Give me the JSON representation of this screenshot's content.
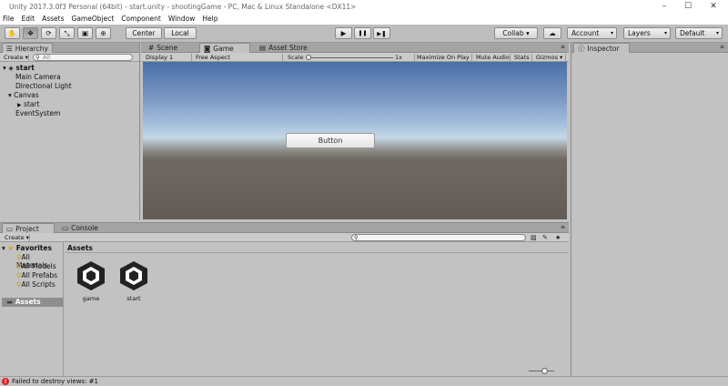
{
  "window": {
    "title": "Unity 2017.3.0f3 Personal (64bit) - start.unity - shootingGame - PC, Mac & Linux Standalone <DX11>"
  },
  "window_controls": {
    "minimize": "–",
    "maximize": "☐",
    "close": "✕"
  },
  "menu": [
    "File",
    "Edit",
    "Assets",
    "GameObject",
    "Component",
    "Window",
    "Help"
  ],
  "toolbar": {
    "pivot_label": "Center",
    "space_label": "Local",
    "play_icon": "▶",
    "pause_icon": "❚❚",
    "step_icon": "▶❚",
    "collab_label": "Collab ▾",
    "cloud_icon": "☁",
    "account_label": "Account",
    "layers_label": "Layers",
    "layout_label": "Default",
    "tools": [
      {
        "name": "hand-tool-icon",
        "glyph": "✋"
      },
      {
        "name": "move-tool-icon",
        "glyph": "✥"
      },
      {
        "name": "rotate-tool-icon",
        "glyph": "⟳"
      },
      {
        "name": "scale-tool-icon",
        "glyph": "⤡"
      },
      {
        "name": "rect-tool-icon",
        "glyph": "▣"
      },
      {
        "name": "transform-tool-icon",
        "glyph": "⊕"
      }
    ]
  },
  "hierarchy": {
    "tab_label": "Hierarchy",
    "create_label": "Create ▾",
    "search_placeholder": "All",
    "scene_name": "start",
    "items": [
      {
        "label": "Main Camera",
        "indent": 1
      },
      {
        "label": "Directional Light",
        "indent": 1
      },
      {
        "label": "Canvas",
        "indent": 1,
        "expanded": true
      },
      {
        "label": "start",
        "indent": 2,
        "collapsed": true
      },
      {
        "label": "EventSystem",
        "indent": 1
      }
    ]
  },
  "scene_tabs": {
    "scene": "Scene",
    "game": "Game",
    "asset_store": "Asset Store"
  },
  "game_bar": {
    "display": "Display 1",
    "aspect": "Free Aspect",
    "scale_label": "Scale",
    "scale_value": "1x",
    "maximize_on_play": "Maximize On Play",
    "mute_audio": "Mute Audio",
    "stats": "Stats",
    "gizmos": "Gizmos ▾"
  },
  "game_view": {
    "button_label": "Button"
  },
  "inspector": {
    "tab_label": "Inspector"
  },
  "project": {
    "tab_label": "Project",
    "console_tab_label": "Console",
    "create_label": "Create ▾",
    "favorites_label": "Favorites",
    "favorites": [
      "All Materials",
      "All Models",
      "All Prefabs",
      "All Scripts"
    ],
    "assets_root": "Assets",
    "breadcrumb": "Assets",
    "assets": [
      {
        "label": "game"
      },
      {
        "label": "start"
      }
    ]
  },
  "status": {
    "message": "Failed to destroy views: #1"
  },
  "colors": {
    "error": "#d22222",
    "toolbar_bg": "#bdbdbd",
    "panel_bg": "#c2c2c2"
  }
}
